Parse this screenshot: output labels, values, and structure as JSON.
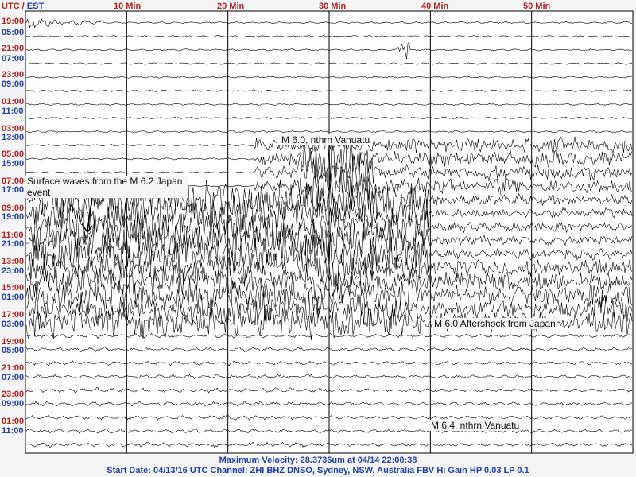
{
  "header": {
    "utc": "UTC",
    "sep": " / ",
    "est": "EST"
  },
  "chart_data": {
    "type": "line",
    "title": "",
    "xlabel": "",
    "ylabel": "",
    "x_ticks": [
      "10 Min",
      "20 Min",
      "30 Min",
      "40 Min",
      "50 Min"
    ],
    "x_tick_minutes": [
      10,
      20,
      30,
      40,
      50
    ],
    "xlim_minutes": [
      0,
      60
    ],
    "trace_count": 32,
    "grid": true,
    "utc_labels": [
      "19:00",
      "21:00",
      "23:00",
      "01:00",
      "03:00",
      "05:00",
      "07:00",
      "09:00",
      "11:00",
      "13:00",
      "15:00",
      "17:00",
      "19:00",
      "21:00",
      "23:00",
      "01:00"
    ],
    "est_labels": [
      "05:00",
      "07:00",
      "09:00",
      "11:00",
      "13:00",
      "15:00",
      "17:00",
      "19:00",
      "21:00",
      "23:00",
      "01:00",
      "03:00",
      "05:00",
      "07:00",
      "09:00",
      "11:00"
    ],
    "annotations": [
      "Surface waves from the M 6.2 Japan event",
      "M 6.0, nthrn Vanuatu",
      "M 6.0 Aftershock from Japan",
      "M 6.4, nthrn Vanuatu"
    ]
  },
  "footer": {
    "max_velocity": "Maximum Velocity: 28.3736um at 04/14 22:00:38",
    "start_info": "Start Date: 04/13/16 UTC Channel: ZHI  BHZ  DNSO, Sydney, NSW, Australia  FBV Hi Gain HP 0.03  LP 0.1"
  }
}
